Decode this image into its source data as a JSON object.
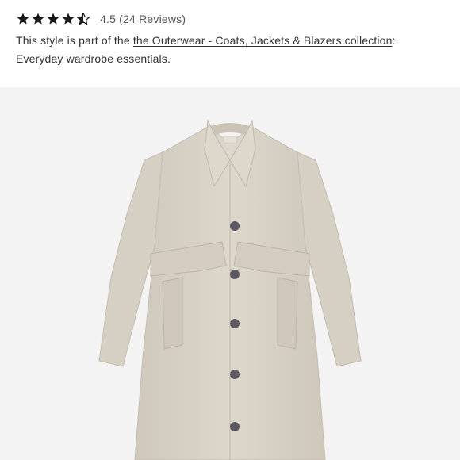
{
  "rating": {
    "stars": 4.5,
    "max_stars": 5,
    "score_text": "4.5",
    "reviews_text": "(24 Reviews)"
  },
  "description": {
    "prefix": "This style is part of the ",
    "collection_link": "the Outerwear - Coats, Jackets & Blazers collection",
    "suffix": ":",
    "line2": "Everyday wardrobe essentials."
  },
  "product_image": {
    "icon": "trench-coat-image",
    "coat_color": "#d9d3c7",
    "button_color": "#5d5963",
    "background_color": "#f3f3f3"
  },
  "colors": {
    "star": "#1a1a1a",
    "text": "#333333",
    "muted": "#555555"
  }
}
